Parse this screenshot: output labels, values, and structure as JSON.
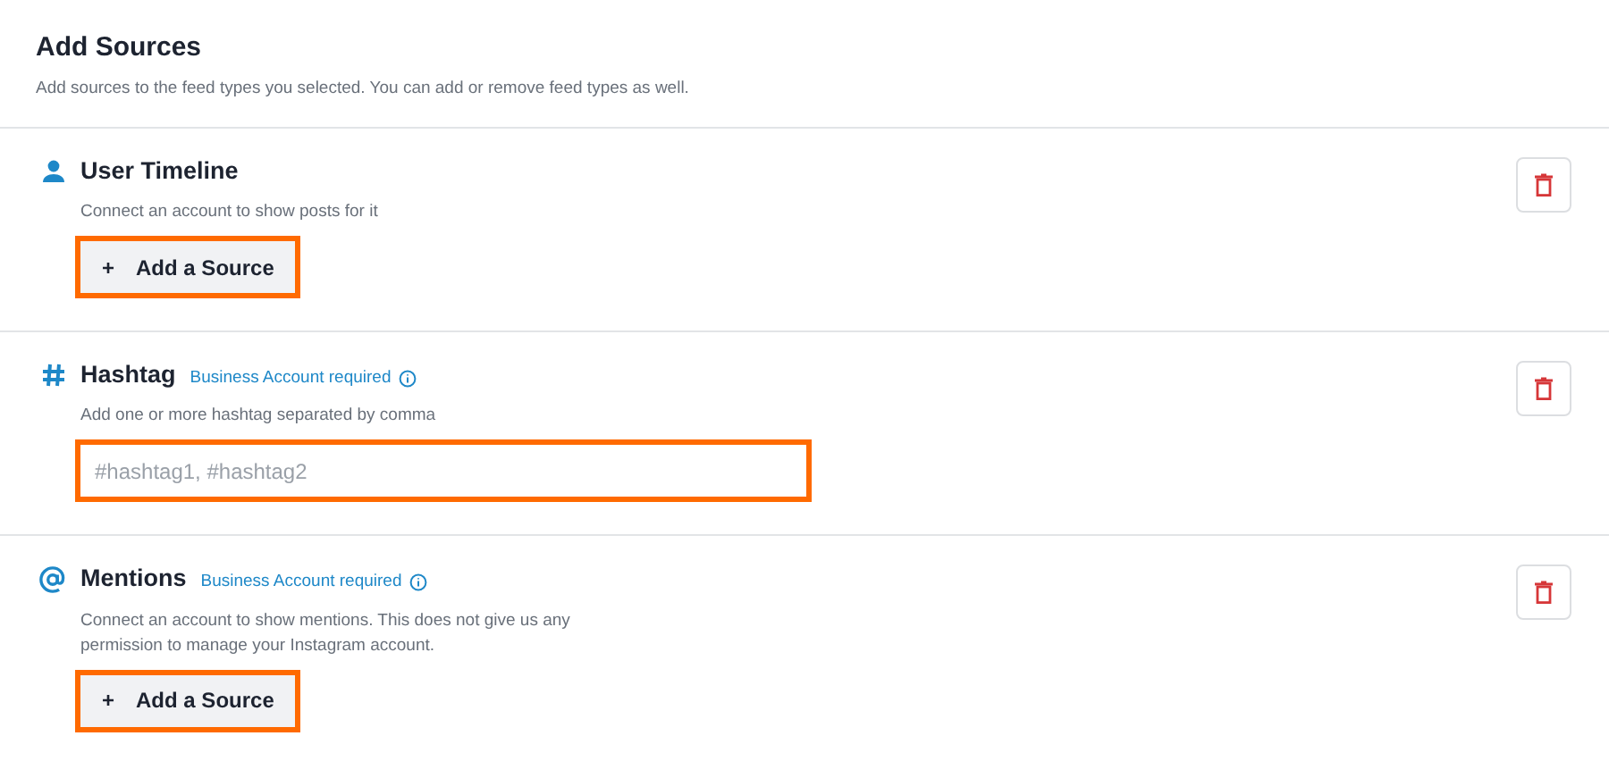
{
  "header": {
    "title": "Add Sources",
    "subtitle": "Add sources to the feed types you selected. You can add or remove feed types as well."
  },
  "sections": [
    {
      "kind": "user",
      "title": "User Timeline",
      "description": "Connect an account to show posts for it",
      "control": {
        "kind": "button",
        "plus": "+",
        "label": "Add a Source",
        "highlighted": true
      }
    },
    {
      "kind": "hashtag",
      "title": "Hashtag",
      "badge": "Business Account required",
      "description": "Add one or more hashtag separated by comma",
      "control": {
        "kind": "input",
        "placeholder": "#hashtag1, #hashtag2",
        "highlighted": true
      }
    },
    {
      "kind": "mentions",
      "title": "Mentions",
      "badge": "Business Account required",
      "description": "Connect an account to show mentions. This does not give us any permission to manage your Instagram account.",
      "control": {
        "kind": "button",
        "plus": "+",
        "label": "Add a Source",
        "highlighted": true
      }
    }
  ]
}
